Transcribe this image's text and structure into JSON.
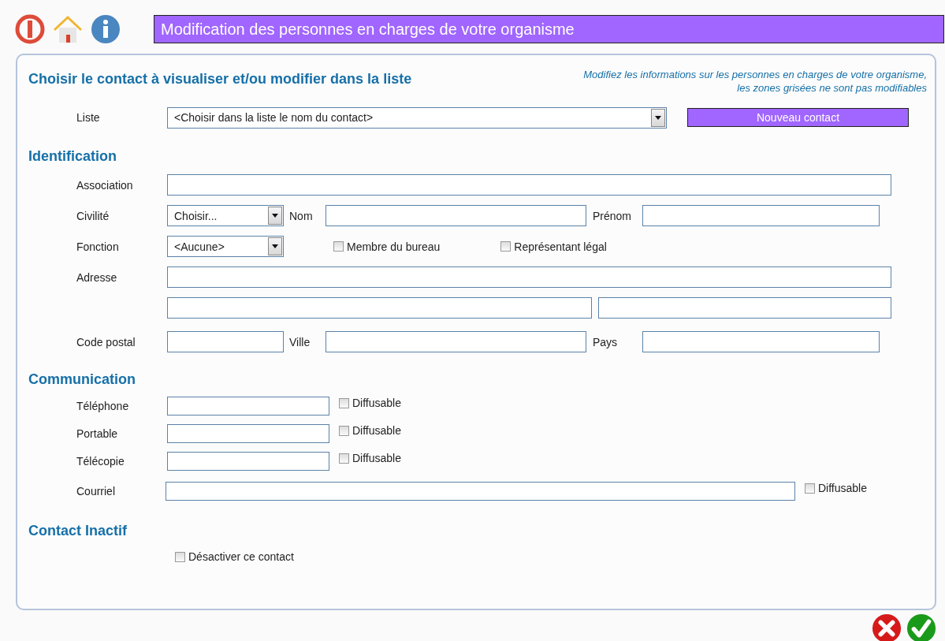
{
  "header": {
    "title": "Modification des personnes en charges de votre organisme"
  },
  "chooser": {
    "heading": "Choisir le contact à visualiser et/ou modifier dans la liste",
    "hint": [
      "Modifiez les informations sur les personnes en charges de votre organisme,",
      "les zones grisées ne sont pas modifiables"
    ],
    "list_label": "Liste",
    "list_value": "<Choisir dans la liste le nom du contact>",
    "new_button": "Nouveau contact"
  },
  "identification": {
    "heading": "Identification",
    "association_label": "Association",
    "civility_label": "Civilité",
    "civility_value": "Choisir...",
    "name_label": "Nom",
    "first_name_label": "Prénom",
    "function_label": "Fonction",
    "function_value": "<Aucune>",
    "checkboxes": [
      {
        "label": "Membre du bureau",
        "checked": false
      },
      {
        "label": "Représentant légal",
        "checked": false
      }
    ],
    "address_label": "Adresse",
    "postcode_label": "Code postal",
    "city_label": "Ville",
    "country_label": "Pays"
  },
  "communication": {
    "heading": "Communication",
    "rows": [
      {
        "kind": "short",
        "label": "Téléphone",
        "checkbox": {
          "label": "Diffusable",
          "checked": false
        }
      },
      {
        "kind": "short",
        "label": "Portable",
        "checkbox": {
          "label": "Diffusable",
          "checked": false
        }
      },
      {
        "kind": "short",
        "label": "Télécopie",
        "checkbox": {
          "label": "Diffusable",
          "checked": false
        }
      },
      {
        "kind": "wide",
        "label": "Courriel",
        "checkbox": {
          "label": "Diffusable",
          "checked": false
        }
      }
    ]
  },
  "inactive": {
    "heading": "Contact Inactif",
    "checkbox": {
      "label": "Désactiver ce contact",
      "checked": false
    }
  }
}
